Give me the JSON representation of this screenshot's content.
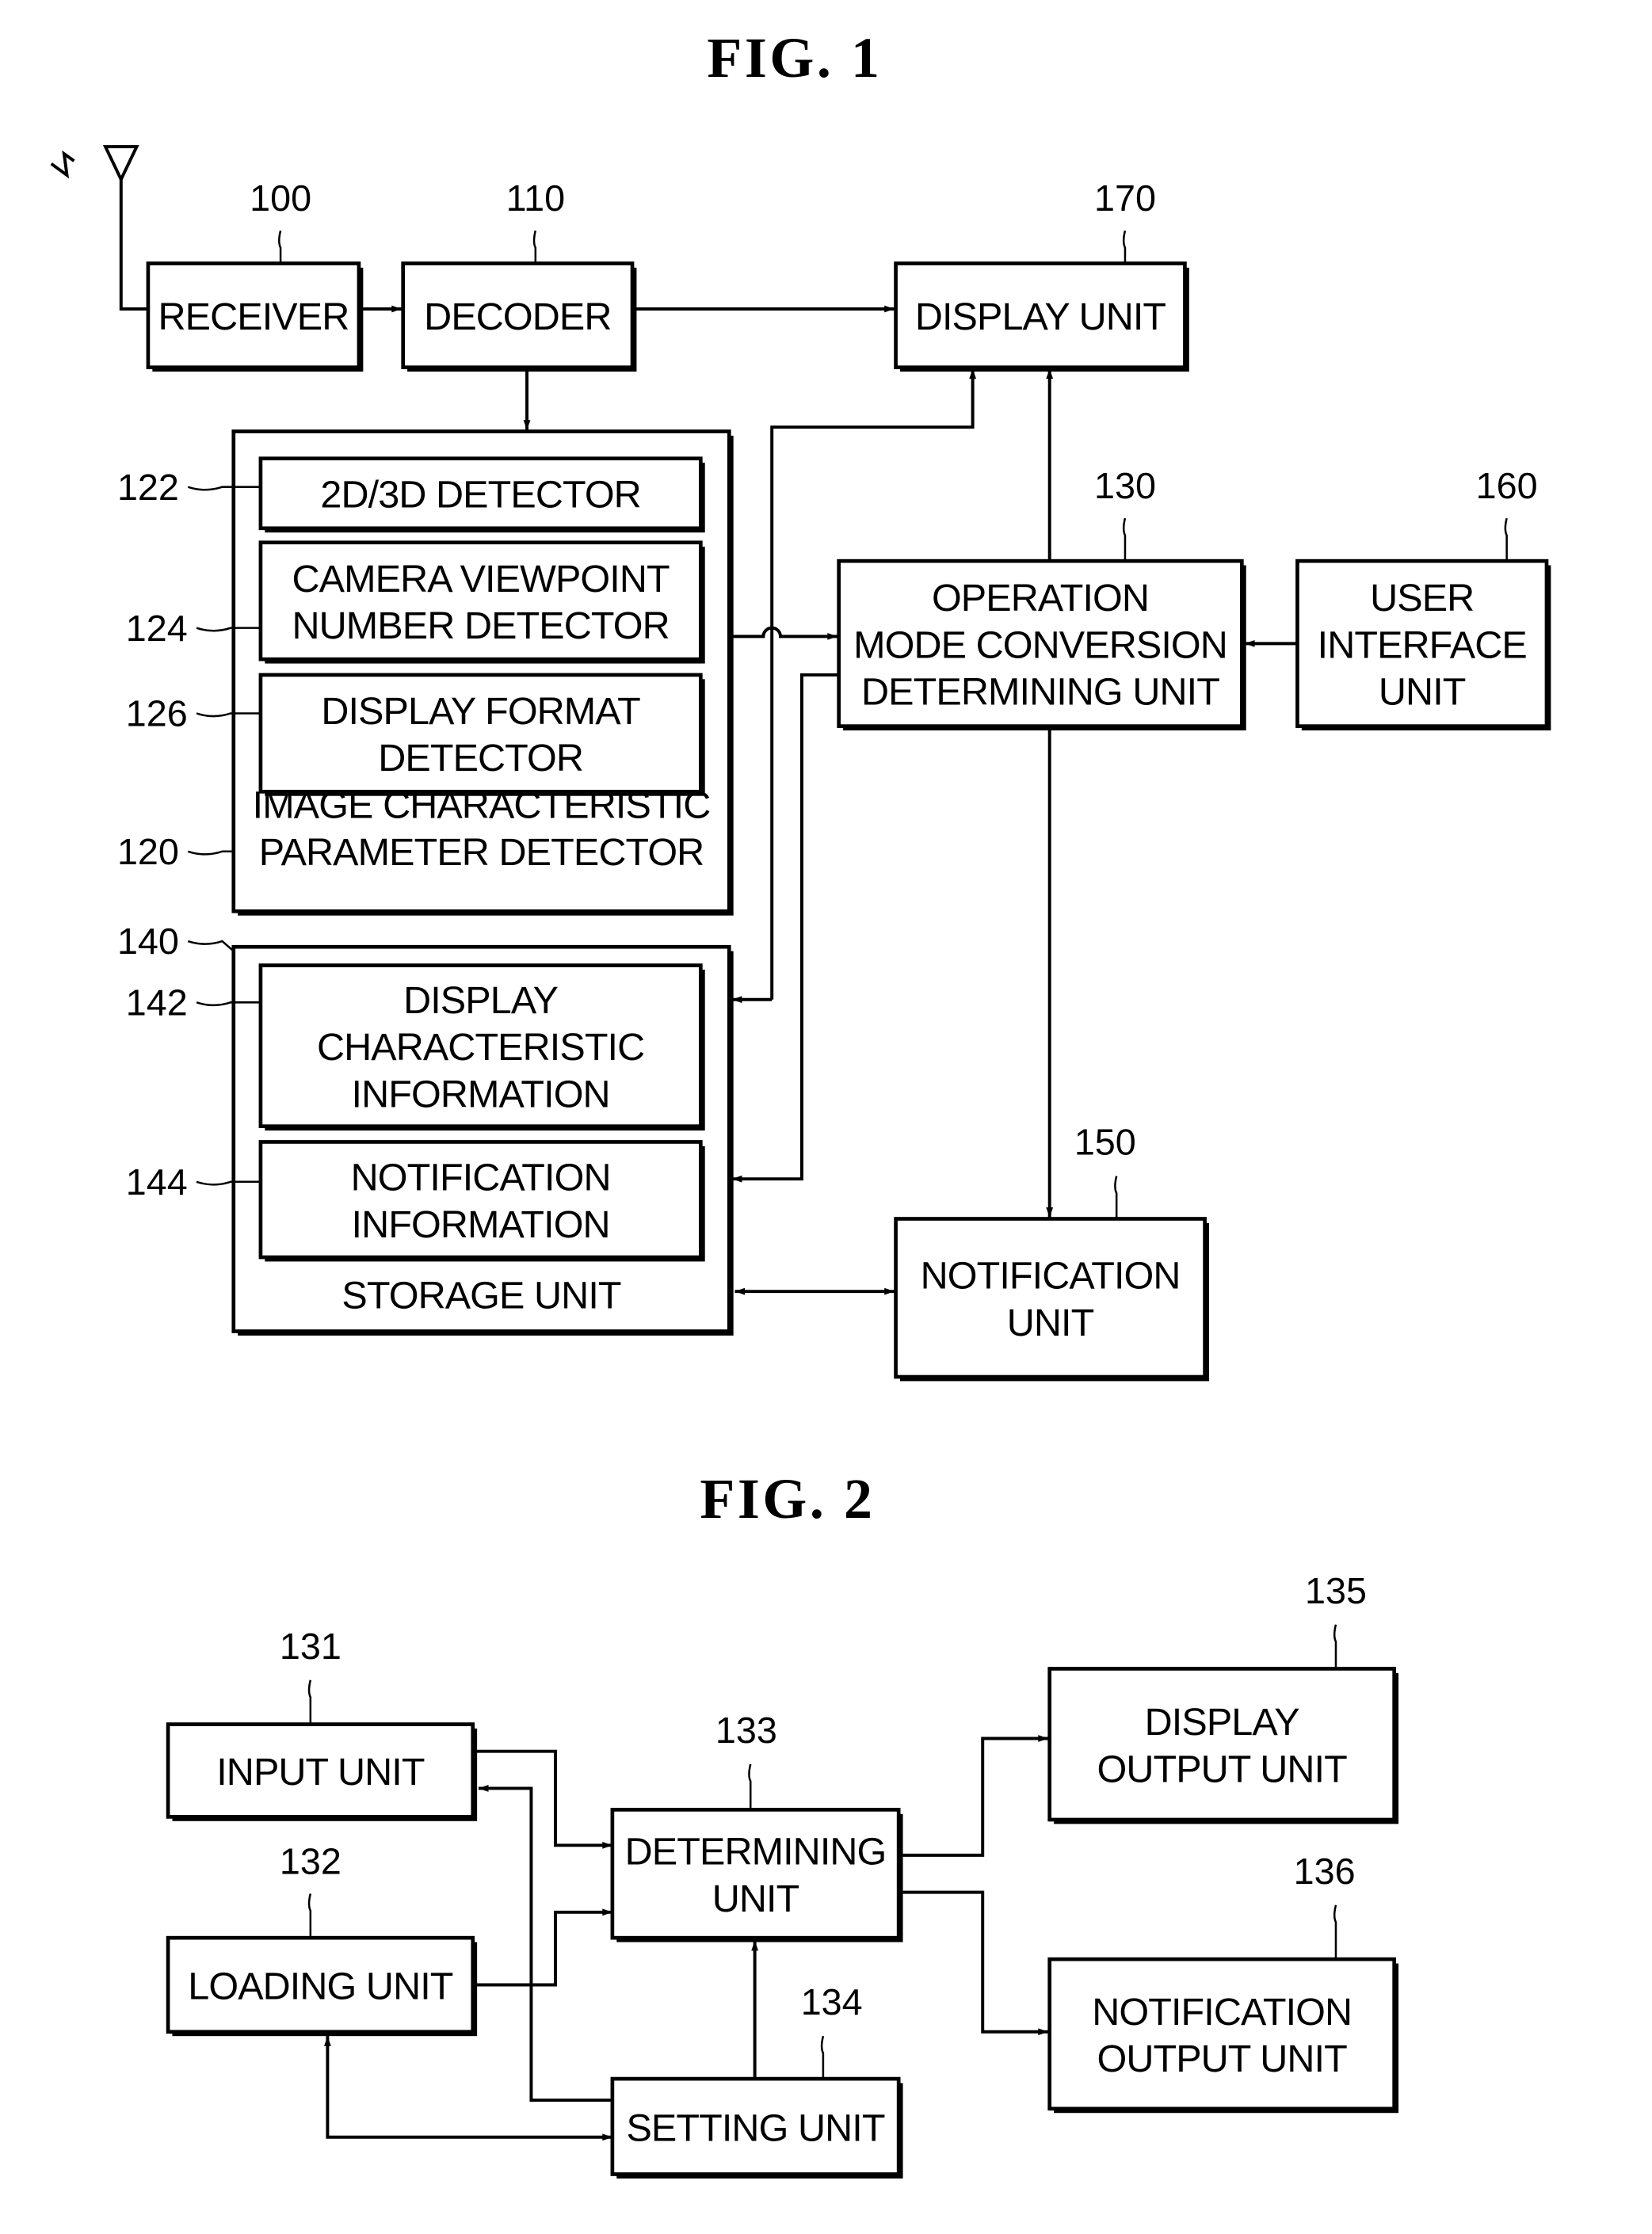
{
  "fig1": {
    "title": "FIG.  1",
    "blocks": {
      "receiver": {
        "ref": "100",
        "lines": [
          "RECEIVER"
        ]
      },
      "decoder": {
        "ref": "110",
        "lines": [
          "DECODER"
        ]
      },
      "display_unit": {
        "ref": "170",
        "lines": [
          "DISPLAY UNIT"
        ]
      },
      "detector_2d3d": {
        "ref": "122",
        "lines": [
          "2D/3D DETECTOR"
        ]
      },
      "camera_viewpoint": {
        "ref": "124",
        "lines": [
          "CAMERA VIEWPOINT",
          "NUMBER DETECTOR"
        ]
      },
      "display_format": {
        "ref": "126",
        "lines": [
          "DISPLAY FORMAT",
          "DETECTOR"
        ]
      },
      "image_param_detector": {
        "ref": "120",
        "lines": [
          "IMAGE CHARACTERISTIC",
          "PARAMETER DETECTOR"
        ]
      },
      "op_mode": {
        "ref": "130",
        "lines": [
          "OPERATION",
          "MODE CONVERSION",
          "DETERMINING UNIT"
        ]
      },
      "user_interface": {
        "ref": "160",
        "lines": [
          "USER",
          "INTERFACE",
          "UNIT"
        ]
      },
      "storage_unit": {
        "ref": "140",
        "lines": [
          "STORAGE UNIT"
        ]
      },
      "display_char_info": {
        "ref": "142",
        "lines": [
          "DISPLAY",
          "CHARACTERISTIC",
          "INFORMATION"
        ]
      },
      "notification_info": {
        "ref": "144",
        "lines": [
          "NOTIFICATION",
          "INFORMATION"
        ]
      },
      "notification_unit": {
        "ref": "150",
        "lines": [
          "NOTIFICATION",
          "UNIT"
        ]
      }
    }
  },
  "fig2": {
    "title": "FIG.  2",
    "blocks": {
      "input_unit": {
        "ref": "131",
        "lines": [
          "INPUT UNIT"
        ]
      },
      "loading_unit": {
        "ref": "132",
        "lines": [
          "LOADING UNIT"
        ]
      },
      "determining_unit": {
        "ref": "133",
        "lines": [
          "DETERMINING",
          "UNIT"
        ]
      },
      "setting_unit": {
        "ref": "134",
        "lines": [
          "SETTING UNIT"
        ]
      },
      "display_output": {
        "ref": "135",
        "lines": [
          "DISPLAY",
          "OUTPUT UNIT"
        ]
      },
      "notification_output": {
        "ref": "136",
        "lines": [
          "NOTIFICATION",
          "OUTPUT UNIT"
        ]
      }
    }
  }
}
